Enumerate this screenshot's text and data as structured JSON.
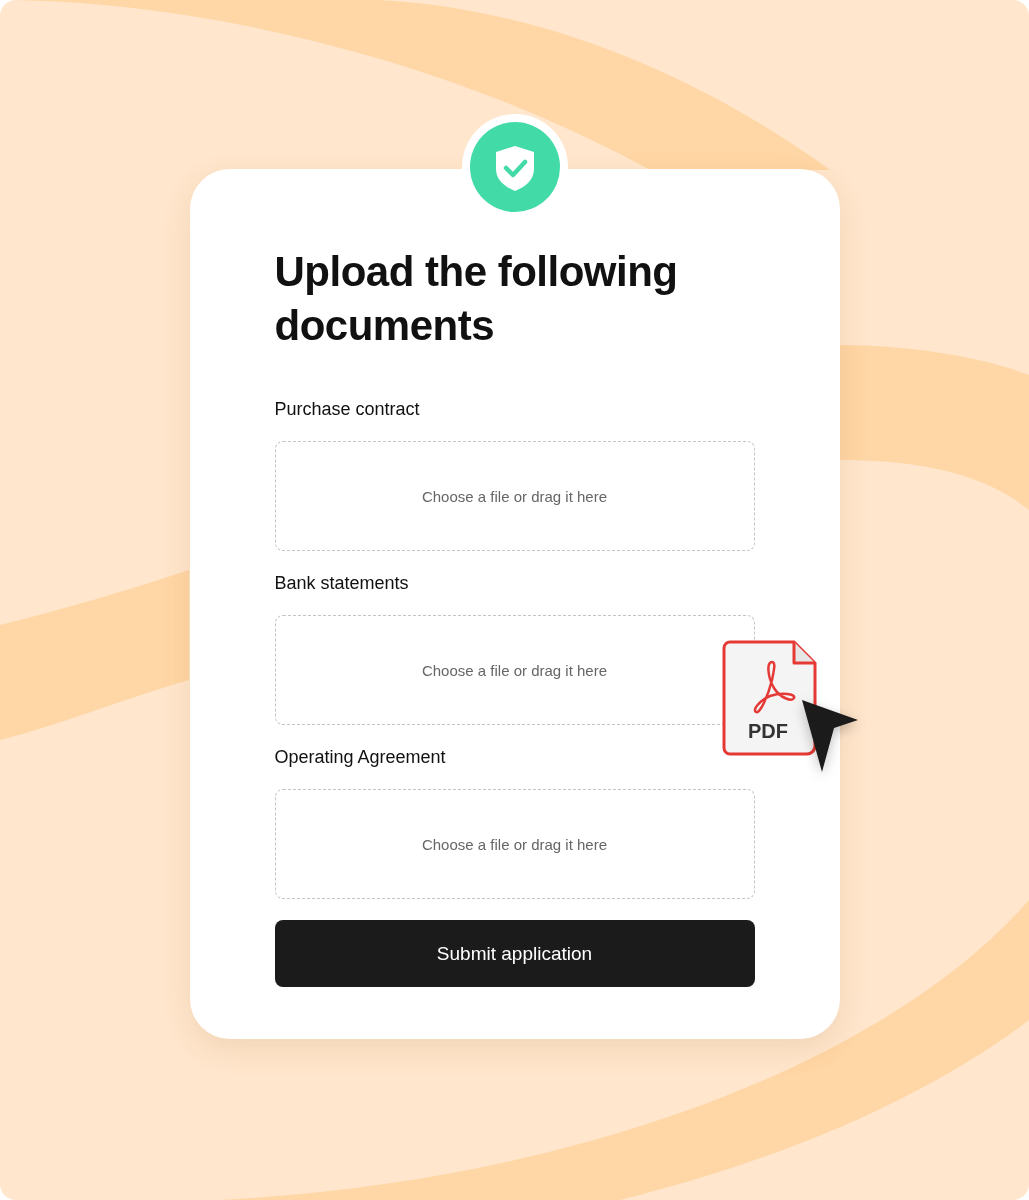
{
  "title": "Upload the following documents",
  "uploads": [
    {
      "label": "Purchase contract",
      "prompt": "Choose a file or drag it here"
    },
    {
      "label": "Bank statements",
      "prompt": "Choose a file or drag it here"
    },
    {
      "label": "Operating Agreement",
      "prompt": "Choose a file or drag it here"
    }
  ],
  "file_badge": {
    "label": "PDF"
  },
  "submit": {
    "label": "Submit application"
  }
}
